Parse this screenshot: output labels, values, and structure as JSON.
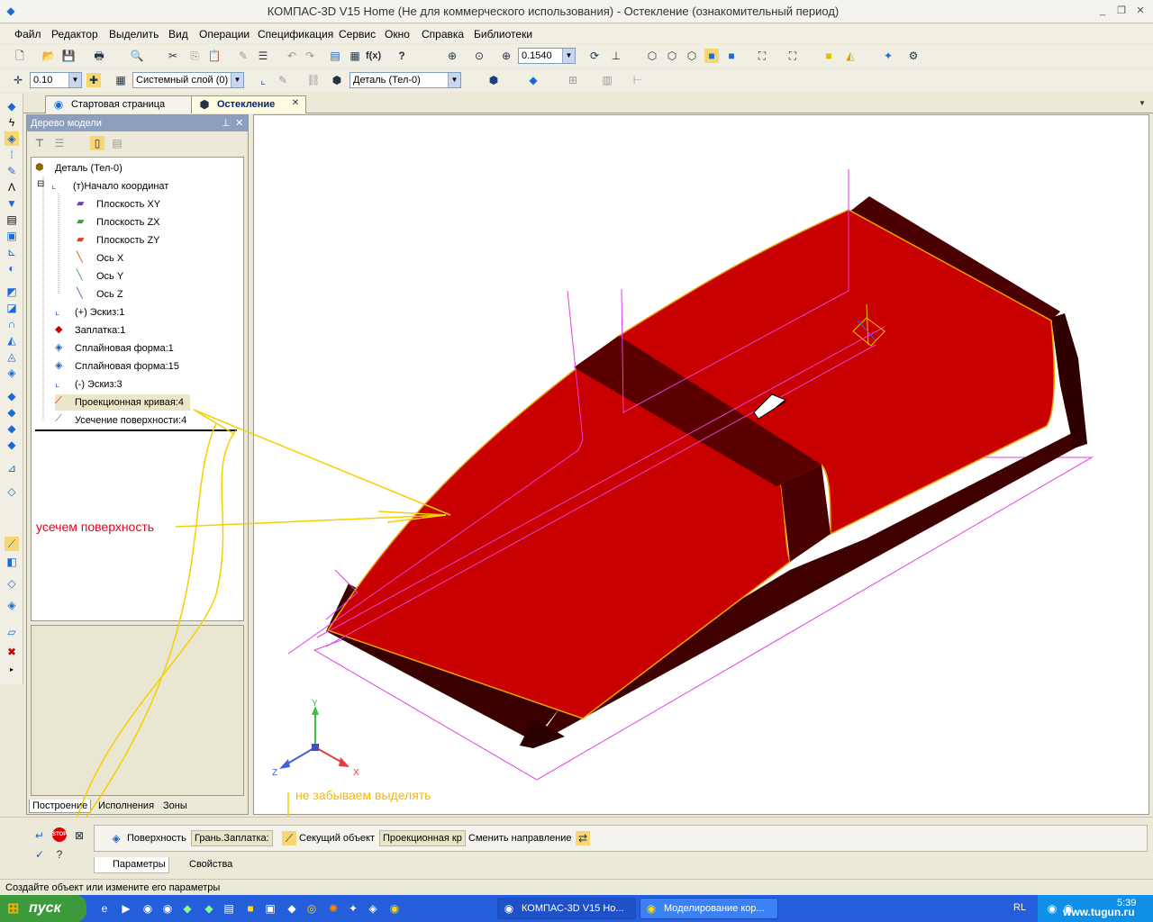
{
  "window": {
    "title": "КОМПАС-3D V15 Home (Не для коммерческого использования) - Остекление (ознакомительный период)",
    "btn_minimize": "_",
    "btn_restore": "❐",
    "btn_close": "✕"
  },
  "menu": [
    "Файл",
    "Редактор",
    "Выделить",
    "Вид",
    "Операции",
    "Спецификация",
    "Сервис",
    "Окно",
    "Справка",
    "Библиотеки"
  ],
  "toolbar": {
    "zoom_value": "0.1540",
    "step_value": "0.10",
    "layer_value": "Системный слой (0)",
    "detail_value": "Деталь (Тел-0)",
    "fx_label": "f(x)"
  },
  "tabs": [
    {
      "label": "Стартовая страница",
      "active": false
    },
    {
      "label": "Остекление",
      "active": true
    }
  ],
  "tree_panel": {
    "title": "Дерево модели",
    "pin": "⊥",
    "close": "✕",
    "items": [
      {
        "label": "Деталь (Тел-0)",
        "icon": "part-icon"
      },
      {
        "label": "(т)Начало координат",
        "icon": "origin-icon",
        "expander": "⊟"
      },
      {
        "label": "Плоскость XY",
        "icon": "plane-xy-icon"
      },
      {
        "label": "Плоскость ZX",
        "icon": "plane-zx-icon"
      },
      {
        "label": "Плоскость ZY",
        "icon": "plane-zy-icon"
      },
      {
        "label": "Ось X",
        "icon": "axis-x-icon"
      },
      {
        "label": "Ось Y",
        "icon": "axis-y-icon"
      },
      {
        "label": "Ось Z",
        "icon": "axis-z-icon"
      },
      {
        "label": "(+) Эскиз:1",
        "icon": "sketch-icon"
      },
      {
        "label": "Заплатка:1",
        "icon": "patch-icon"
      },
      {
        "label": "Сплайновая форма:1",
        "icon": "spline-form-icon"
      },
      {
        "label": "Сплайновая форма:15",
        "icon": "spline-form-icon"
      },
      {
        "label": "(-) Эскиз:3",
        "icon": "sketch-icon"
      },
      {
        "label": "Проекционная кривая:4",
        "icon": "projection-curve-icon"
      },
      {
        "label": "Усечение поверхности:4",
        "icon": "surface-trim-icon"
      }
    ],
    "bottom_tabs": [
      "Построение",
      "Исполнения",
      "Зоны"
    ]
  },
  "annotations": {
    "cut_surface": "усечем поверхность",
    "dont_forget": "не забываем выделять",
    "colors": {
      "red_note": "#e8001c",
      "yellow_note": "#f5b800",
      "arrow": "#f5d000"
    }
  },
  "viewport": {
    "model_color": "#c80000",
    "axis_labels": {
      "x": "X",
      "y": "Y",
      "z": "Z"
    }
  },
  "property_bar": {
    "surface_label": "Поверхность",
    "surface_value": "Грань.Заплатка:",
    "cutting_label": "Секущий объект",
    "cutting_value": "Проекционная кр",
    "direction_label": "Сменить направление",
    "tab_params": "Параметры",
    "tab_props": "Свойства",
    "stop_label": "STOP"
  },
  "status_text": "Создайте объект или измените его параметры",
  "taskbar": {
    "start": "пуск",
    "tasks": [
      "КОМПАС-3D V15 Ho...",
      "Моделирование кор..."
    ],
    "lang": "RL",
    "clock": "5:39",
    "watermark": "www.tugun.ru"
  }
}
